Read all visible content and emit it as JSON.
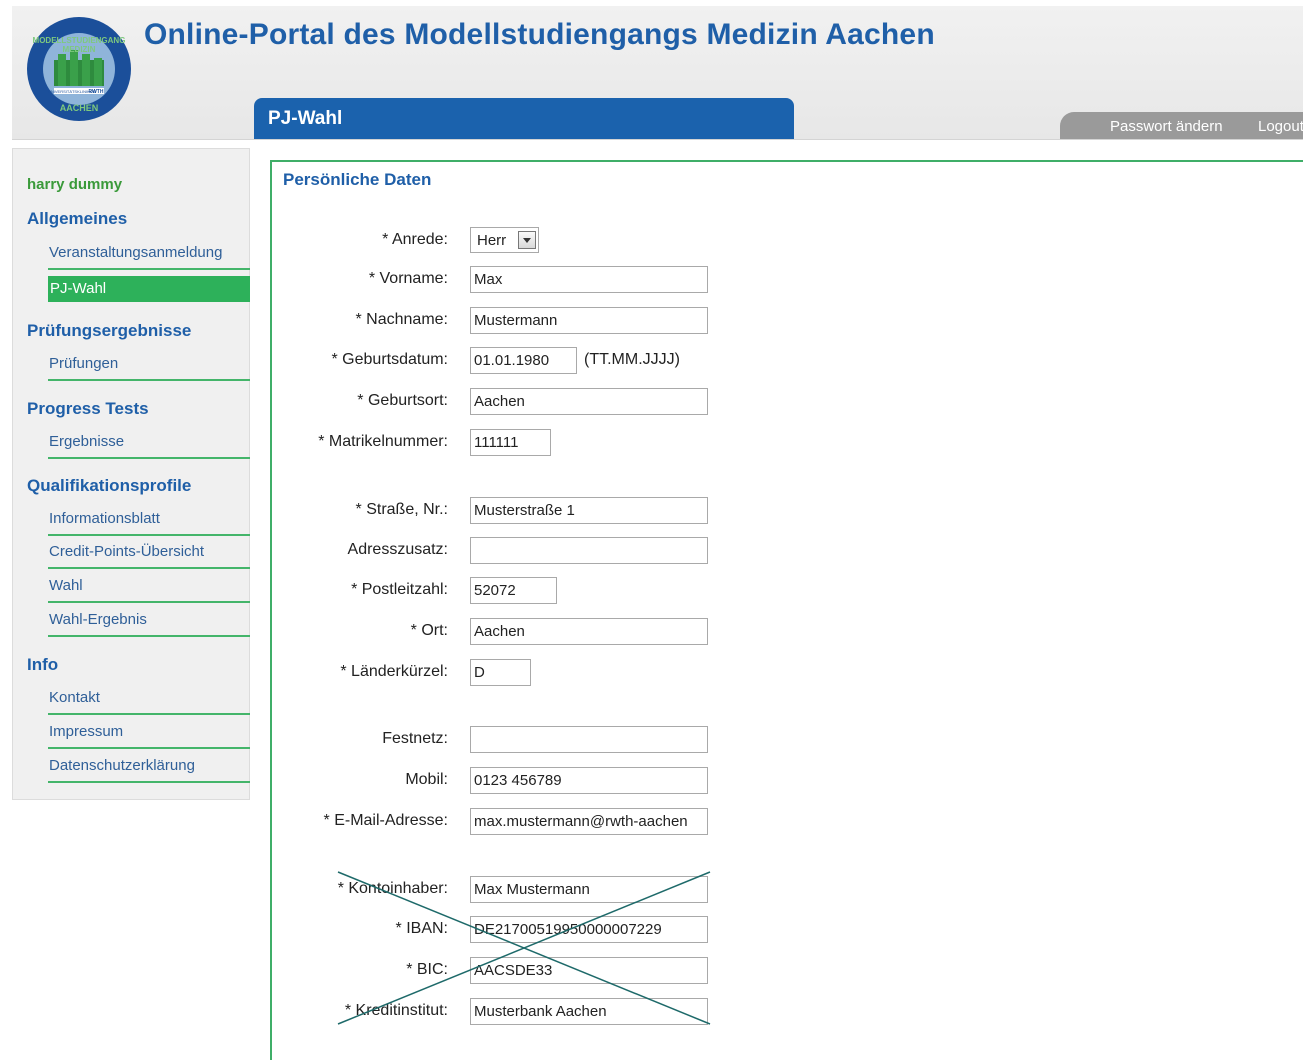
{
  "header": {
    "title": "Online-Portal des Modellstudiengangs Medizin Aachen",
    "page_tab": "PJ-Wahl",
    "account": {
      "change_password": "Passwort ändern",
      "logout": "Logout"
    }
  },
  "sidebar": {
    "user": "harry dummy",
    "sections": [
      {
        "title": "Allgemeines",
        "items": [
          "Veranstaltungsanmeldung",
          "PJ-Wahl"
        ]
      },
      {
        "title": "Prüfungsergebnisse",
        "items": [
          "Prüfungen"
        ]
      },
      {
        "title": "Progress Tests",
        "items": [
          "Ergebnisse"
        ]
      },
      {
        "title": "Qualifikationsprofile",
        "items": [
          "Informationsblatt",
          "Credit-Points-Übersicht",
          "Wahl",
          "Wahl-Ergebnis"
        ]
      },
      {
        "title": "Info",
        "items": [
          "Kontakt",
          "Impressum",
          "Datenschutzerklärung"
        ]
      }
    ],
    "active_item": "PJ-Wahl"
  },
  "form": {
    "title": "Persönliche Daten",
    "anrede": {
      "label": "* Anrede:",
      "value": "Herr"
    },
    "vorname": {
      "label": "* Vorname:",
      "value": "Max"
    },
    "nachname": {
      "label": "* Nachname:",
      "value": "Mustermann"
    },
    "geburtsdatum": {
      "label": "* Geburtsdatum:",
      "value": "01.01.1980",
      "hint": "(TT.MM.JJJJ)"
    },
    "geburtsort": {
      "label": "* Geburtsort:",
      "value": "Aachen"
    },
    "matrikelnummer": {
      "label": "* Matrikelnummer:",
      "value": "111111"
    },
    "strasse": {
      "label": "* Straße, Nr.:",
      "value": "Musterstraße 1"
    },
    "adresszusatz": {
      "label": "Adresszusatz:",
      "value": ""
    },
    "postleitzahl": {
      "label": "* Postleitzahl:",
      "value": "52072"
    },
    "ort": {
      "label": "* Ort:",
      "value": "Aachen"
    },
    "laenderkuerzel": {
      "label": "* Länderkürzel:",
      "value": "D"
    },
    "festnetz": {
      "label": "Festnetz:",
      "value": ""
    },
    "mobil": {
      "label": "Mobil:",
      "value": "0123 456789"
    },
    "email": {
      "label": "* E-Mail-Adresse:",
      "value": "max.mustermann@rwth-aachen"
    },
    "kontoinhaber": {
      "label": "* Kontoinhaber:",
      "value": "Max Mustermann"
    },
    "iban": {
      "label": "* IBAN:",
      "value": "DE21700519950000007229"
    },
    "bic": {
      "label": "* BIC:",
      "value": "AACSDE33"
    },
    "kreditinstitut": {
      "label": "* Kreditinstitut:",
      "value": "Musterbank Aachen"
    }
  },
  "logo_text": {
    "arc_top": "MODELLSTUDIENGANG MEDIZIN",
    "arc_bottom": "AACHEN",
    "university": "UNIVERSITÄTSKLINIKUM",
    "rwth": "RWTH"
  },
  "colors": {
    "brand_blue": "#1b62ad",
    "nav_green": "#2db15a",
    "accent_green": "#3fae68"
  }
}
